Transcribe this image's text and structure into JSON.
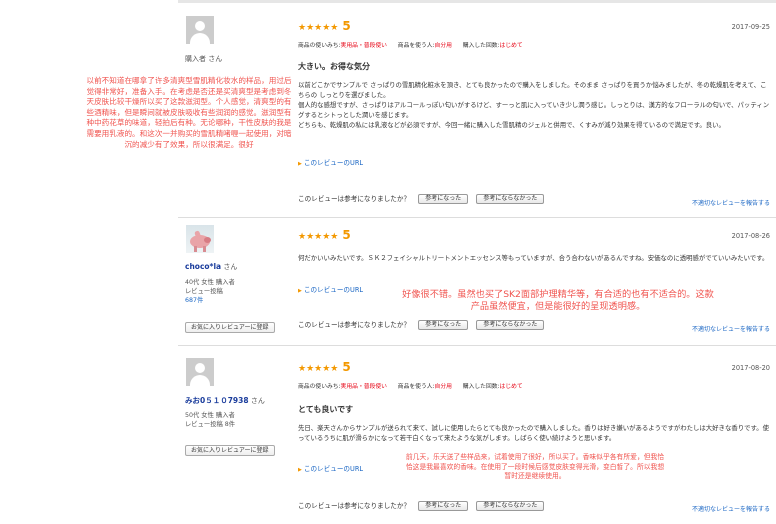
{
  "reviews": [
    {
      "user": {
        "name": "購入者",
        "honorific": "さん"
      },
      "stars": "★★★★★",
      "score": "5",
      "date": "2017-09-25",
      "tags": {
        "usage_label": "商品の使いみち:",
        "usage": "実用品・普段使い",
        "target_label": "商品を使う人:",
        "target": "自分用",
        "times_label": "購入した回数:",
        "times": "はじめて"
      },
      "title": "大きい。お得な気分",
      "body": "以前どこかでサンプルで さっぱりの雪肌精化粧水を頂き、とても良かったので購入をしました。そのまま さっぱりを買うか悩みましたが、冬の乾燥肌を考えて、こちらの しっとりを選びました。\n個人的な感想ですが、さっぱりはアルコールっぽい匂いがするけど、すーっと肌に入っていき少し潤う感じ。しっとりは、漢方的なフローラルの匂いで、パッティングするとシトっとした潤いを感じます。\nどちらも、乾燥肌の私には乳液などが必須ですが、今回一緒に購入した雪肌精のジェルと併用で、くすみが減り効果を得ているので満足です。良い。",
      "url_label": "このレビューのURL",
      "helpful_q": "このレビューは参考になりましたか？",
      "yes": "参考になった",
      "no": "参考にならなかった",
      "report": "不適切なレビューを報告する"
    },
    {
      "user": {
        "name": "choco*la",
        "honorific": "さん",
        "meta1": "40代 女性  購入者",
        "meta2": "レビュー投稿",
        "count": "687件",
        "fav": "お気に入りレビュアーに登録"
      },
      "stars": "★★★★★",
      "score": "5",
      "date": "2017-08-26",
      "body": "何だかいいみたいです。ＳＫ２フェイシャルトリートメントエッセンス等もっていますが、合う合わないがあるんですね。安価なのに透明感がでていいみたいです。",
      "url_label": "このレビューのURL",
      "helpful_q": "このレビューは参考になりましたか？",
      "yes": "参考になった",
      "no": "参考にならなかった",
      "report": "不適切なレビューを報告する"
    },
    {
      "user": {
        "name": "みお0５１０7938",
        "honorific": "さん",
        "meta1": "50代 女性  購入者",
        "meta2": "レビュー投稿  8件",
        "fav": "お気に入りレビュアーに登録"
      },
      "stars": "★★★★★",
      "score": "5",
      "date": "2017-08-20",
      "tags": {
        "usage_label": "商品の使いみち:",
        "usage": "実用品・普段使い",
        "target_label": "商品を使う人:",
        "target": "自分用",
        "times_label": "購入した回数:",
        "times": "はじめて"
      },
      "title": "とても良いです",
      "body": "先日、楽天さんからサンプルが送られて来て、試しに使用したらとても良かったので購入しました。香りは好き嫌いがあるようですがわたしは大好きな香りです。使っているうちに肌が滑らかになって若干白くなって来たような気がします。しばらく使い続けようと思います。",
      "url_label": "このレビューのURL",
      "helpful_q": "このレビューは参考になりましたか？",
      "yes": "参考になった",
      "no": "参考にならなかった",
      "report": "不適切なレビューを報告する"
    }
  ],
  "notes": {
    "n1": "以前不知道在哪拿了许多清爽型雪肌精化妆水的样品，用过后觉得非常好，准备入手。在考虑是否还是买清爽型是考虑到冬天皮肤比较干燥所以买了这款滋润型。个人感觉，清爽型的有些酒精味，但是瞬间就被皮肤吸收有些润润的感觉。滋润型有种中药花草的味道，轻拍后有种。无论哪种，干性皮肤的我是需要用乳液的。和这次一并购买的雪肌精啫喱一起使用，对暗沉的减少有了效果，所以很满足。很好",
    "n2": "好像很不错。虽然也买了SK2面部护理精华等，有合适的也有不适合的。这款产品虽然便宜，但是能很好的呈现透明感。",
    "n3": "前几天，乐天送了些样品来，试着使用了很好，所以买了。香味似乎各有所爱，但我恰恰这是我最喜欢的香味。在使用了一段时候后感觉皮肤变得光滑，变白皙了。所以我想暂时还是继续使用。"
  }
}
